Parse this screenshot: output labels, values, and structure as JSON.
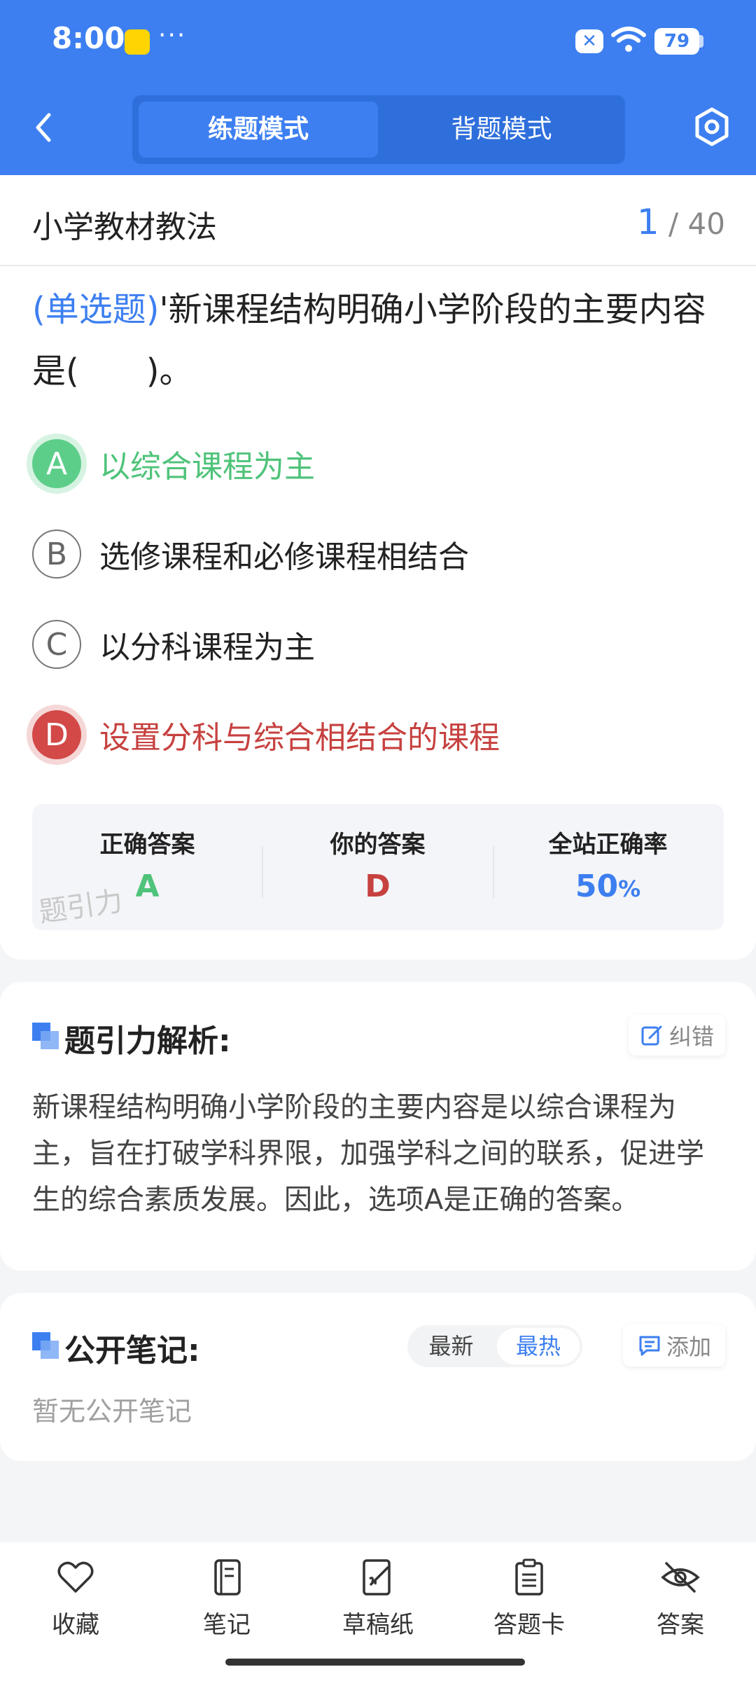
{
  "status_bar": {
    "time": "8:00",
    "dots": "···",
    "battery": "79"
  },
  "header": {
    "tabs": [
      {
        "label": "练题模式",
        "active": true
      },
      {
        "label": "背题模式",
        "active": false
      }
    ],
    "accent_color": "#3d7ff0"
  },
  "question": {
    "subject": "小学教材教法",
    "current": "1",
    "total": "/ 40",
    "type": "(单选题)",
    "text": "'新课程结构明确小学阶段的主要内容是(　　)。",
    "options": [
      {
        "letter": "A",
        "text": "以综合课程为主",
        "state": "correct"
      },
      {
        "letter": "B",
        "text": "选修课程和必修课程相结合",
        "state": "normal"
      },
      {
        "letter": "C",
        "text": "以分科课程为主",
        "state": "normal"
      },
      {
        "letter": "D",
        "text": "设置分科与综合相结合的课程",
        "state": "wrong"
      }
    ]
  },
  "answer_summary": {
    "correct_label": "正确答案",
    "correct_value": "A",
    "yours_label": "你的答案",
    "yours_value": "D",
    "rate_label": "全站正确率",
    "rate_value": "50",
    "rate_unit": "%",
    "watermark": "题引力"
  },
  "analysis": {
    "title": "题引力解析:",
    "report_label": "纠错",
    "text": "新课程结构明确小学阶段的主要内容是以综合课程为主，旨在打破学科界限，加强学科之间的联系，促进学生的综合素质发展。因此，选项A是正确的答案。"
  },
  "notes": {
    "title": "公开笔记:",
    "sort_latest": "最新",
    "sort_hot": "最热",
    "add_label": "添加",
    "empty_text": "暂无公开笔记"
  },
  "bottom_nav": [
    {
      "label": "收藏",
      "icon": "heart-icon"
    },
    {
      "label": "笔记",
      "icon": "notebook-icon"
    },
    {
      "label": "草稿纸",
      "icon": "draft-paper-icon"
    },
    {
      "label": "答题卡",
      "icon": "answer-sheet-icon"
    },
    {
      "label": "答案",
      "icon": "eye-off-icon"
    }
  ]
}
